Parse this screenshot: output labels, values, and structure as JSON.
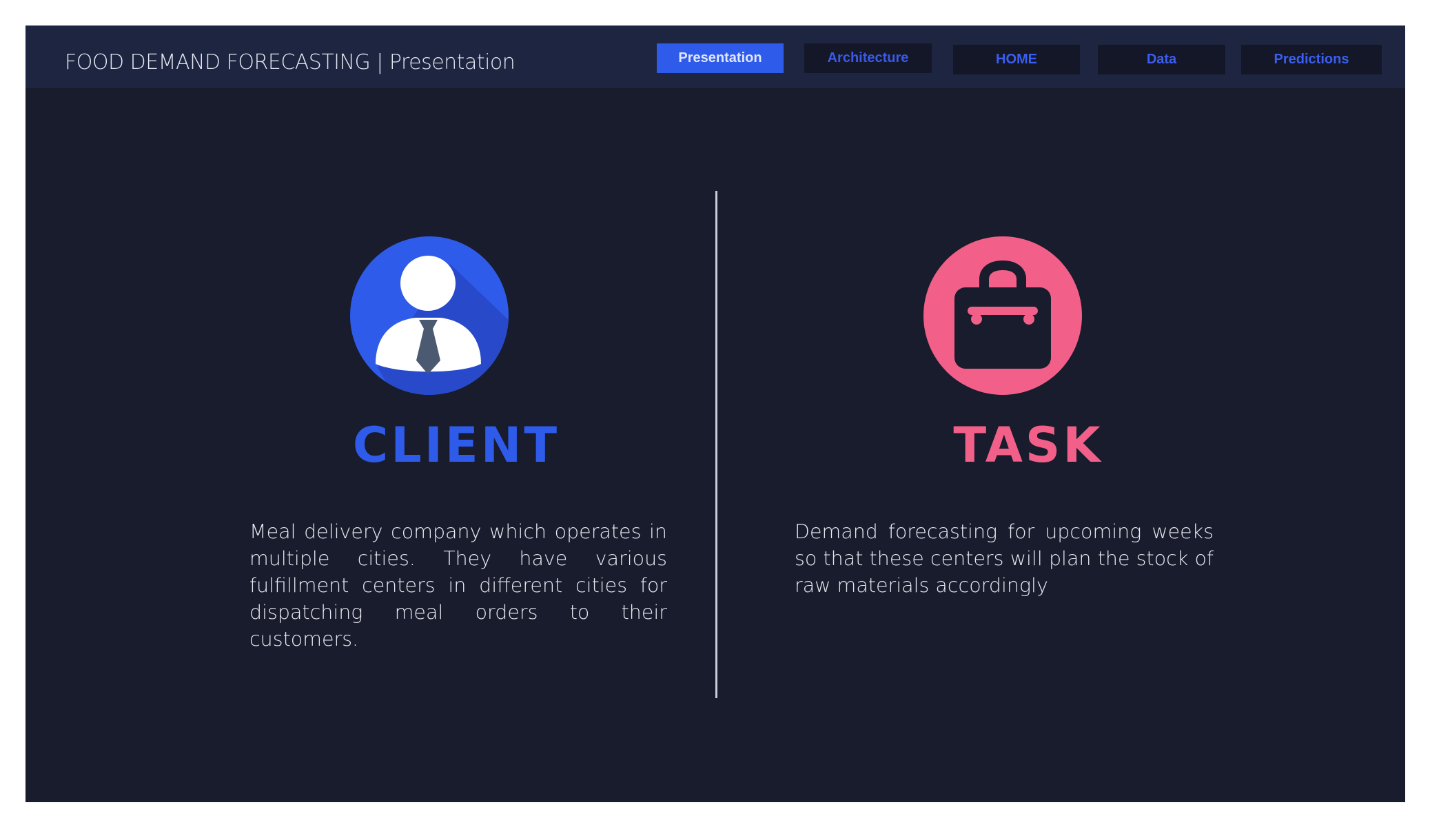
{
  "header": {
    "title": "FOOD DEMAND FORECASTING | Presentation",
    "nav": [
      {
        "label": "Presentation",
        "active": true
      },
      {
        "label": "Architecture",
        "active": false
      },
      {
        "label": "HOME",
        "active": false
      },
      {
        "label": "Data",
        "active": false
      },
      {
        "label": "Predictions",
        "active": false
      }
    ]
  },
  "client": {
    "icon": "businessman-icon",
    "title": "CLIENT",
    "description": "Meal delivery company which operates in multiple cities. They have various fulfillment centers in different cities for dispatching meal orders to their customers."
  },
  "task": {
    "icon": "briefcase-icon",
    "title": "TASK",
    "description": "Demand forecasting for upcoming weeks so that these centers will plan the stock of raw materials accordingly"
  },
  "colors": {
    "background": "#181c2c",
    "header": "#1e2540",
    "client_accent": "#2f5bea",
    "task_accent": "#f26089"
  }
}
